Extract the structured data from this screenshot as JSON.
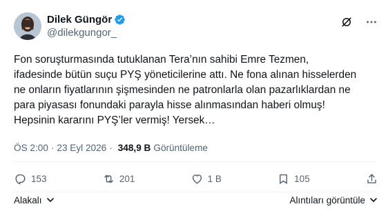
{
  "author": {
    "display_name": "Dilek Güngör",
    "handle": "@dilekgungor_",
    "verified": true,
    "verified_color": "#1d9bf0"
  },
  "post": {
    "lines": [
      "Fon soruşturmasında tutuklanan Tera’nın sahibi Emre Tezmen,",
      "ifadesinde bütün suçu PYŞ yöneticilerine attı. Ne fona alınan hisselerden",
      "ne onların fiyatlarının şişmesinden ne patronlarla olan pazarlıklardan ne",
      "para piyasası fonundaki parayla hisse alınmasından haberi olmuş!",
      "Hepsinin kararını PYŞ’ler vermiş! Yersek…"
    ]
  },
  "meta": {
    "time": "ÖS 2:00",
    "separator": "·",
    "date": "23 Eyl 2026",
    "views_count": "348,9 B",
    "views_label": "Görüntüleme"
  },
  "actions": {
    "replies": "153",
    "reposts": "201",
    "likes": "1 B",
    "bookmarks": "105"
  },
  "footer": {
    "left_label": "Alakalı",
    "right_label": "Alıntıları görüntüle"
  },
  "icons": {
    "verified": "verified-badge-icon",
    "grok": "grok-icon",
    "more": "more-icon",
    "reply": "reply-icon",
    "repost": "repost-icon",
    "like": "heart-icon",
    "bookmark": "bookmark-icon",
    "share": "share-icon",
    "chevron": "chevron-down-icon"
  },
  "colors": {
    "text_primary": "#0f1419",
    "text_secondary": "#536471",
    "divider": "#eff3f4"
  }
}
